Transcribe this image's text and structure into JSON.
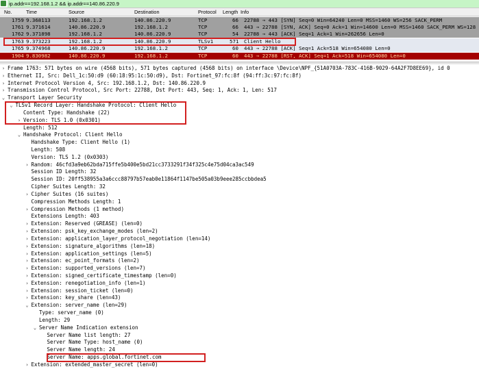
{
  "filter": {
    "value": "ip.addr==192.168.1.2 && ip.addr==140.86.220.9"
  },
  "columns": [
    "No.",
    "Time",
    "Source",
    "Destination",
    "Protocol",
    "Length",
    "Info"
  ],
  "packets": [
    {
      "no": "1759",
      "time": "9.368113",
      "src": "192.168.1.2",
      "dst": "140.86.220.9",
      "proto": "TCP",
      "len": "66",
      "info": "22788 → 443 [SYN] Seq=0 Win=64240 Len=0 MSS=1460 WS=256 SACK_PERM"
    },
    {
      "no": "1761",
      "time": "9.371614",
      "src": "140.86.220.9",
      "dst": "192.168.1.2",
      "proto": "TCP",
      "len": "66",
      "info": "443 → 22788 [SYN, ACK] Seq=0 Ack=1 Win=14600 Len=0 MSS=1460 SACK_PERM WS=128"
    },
    {
      "no": "1762",
      "time": "9.371898",
      "src": "192.168.1.2",
      "dst": "140.86.220.9",
      "proto": "TCP",
      "len": "54",
      "info": "22788 → 443 [ACK] Seq=1 Ack=1 Win=262656 Len=0"
    },
    {
      "no": "1763",
      "time": "9.373223",
      "src": "192.168.1.2",
      "dst": "140.86.220.9",
      "proto": "TLSv1",
      "len": "571",
      "info": "Client Hello"
    },
    {
      "no": "1765",
      "time": "9.374968",
      "src": "140.86.220.9",
      "dst": "192.168.1.2",
      "proto": "TCP",
      "len": "60",
      "info": "443 → 22788 [ACK] Seq=1 Ack=518 Win=654080 Len=0"
    },
    {
      "no": "1904",
      "time": "9.830982",
      "src": "140.86.220.9",
      "dst": "192.168.1.2",
      "proto": "TCP",
      "len": "60",
      "info": "443 → 22788 [RST, ACK] Seq=1 Ack=518 Win=654080 Len=0"
    }
  ],
  "details": [
    {
      "t": ">",
      "text": "Frame 1763: 571 bytes on wire (4568 bits), 571 bytes captured (4568 bits) on interface \\Device\\NPF_{51A0703A-783C-416B-9029-64A2F7D8EE69}, id 0"
    },
    {
      "t": ">",
      "text": "Ethernet II, Src: Dell_1c:50:d9 (60:18:95:1c:50:d9), Dst: Fortinet_97:fc:8f (94:ff:3c:97:fc:8f)"
    },
    {
      "t": ">",
      "text": "Internet Protocol Version 4, Src: 192.168.1.2, Dst: 140.86.220.9"
    },
    {
      "t": ">",
      "text": "Transmission Control Protocol, Src Port: 22788, Dst Port: 443, Seq: 1, Ack: 1, Len: 517"
    },
    {
      "t": "v",
      "text": "Transport Layer Security"
    },
    {
      "t": "v",
      "text": "TLSv1 Record Layer: Handshake Protocol: Client Hello"
    },
    {
      "t": "",
      "text": "Content Type: Handshake (22)"
    },
    {
      "t": ">",
      "text": "Version: TLS 1.0 (0x0301)"
    },
    {
      "t": "",
      "text": "Length: 512"
    },
    {
      "t": "v",
      "text": "Handshake Protocol: Client Hello"
    },
    {
      "t": "",
      "text": "Handshake Type: Client Hello (1)"
    },
    {
      "t": "",
      "text": "Length: 508"
    },
    {
      "t": "",
      "text": "Version: TLS 1.2 (0x0303)"
    },
    {
      "t": ">",
      "text": "Random: 46cfd3a9eb62bda715ffe5b400e5bd21cc3733291f34f325c4e75d04ca3ac549"
    },
    {
      "t": "",
      "text": "Session ID Length: 32"
    },
    {
      "t": "",
      "text": "Session ID: 20ff538955a3a6ccc88797b57eab0e11864f1147be505a03b9eee285ccbbdea5"
    },
    {
      "t": "",
      "text": "Cipher Suites Length: 32"
    },
    {
      "t": ">",
      "text": "Cipher Suites (16 suites)"
    },
    {
      "t": "",
      "text": "Compression Methods Length: 1"
    },
    {
      "t": ">",
      "text": "Compression Methods (1 method)"
    },
    {
      "t": "",
      "text": "Extensions Length: 403"
    },
    {
      "t": ">",
      "text": "Extension: Reserved (GREASE) (len=0)"
    },
    {
      "t": ">",
      "text": "Extension: psk_key_exchange_modes (len=2)"
    },
    {
      "t": ">",
      "text": "Extension: application_layer_protocol_negotiation (len=14)"
    },
    {
      "t": ">",
      "text": "Extension: signature_algorithms (len=18)"
    },
    {
      "t": ">",
      "text": "Extension: application_settings (len=5)"
    },
    {
      "t": ">",
      "text": "Extension: ec_point_formats (len=2)"
    },
    {
      "t": ">",
      "text": "Extension: supported_versions (len=7)"
    },
    {
      "t": ">",
      "text": "Extension: signed_certificate_timestamp (len=0)"
    },
    {
      "t": ">",
      "text": "Extension: renegotiation_info (len=1)"
    },
    {
      "t": ">",
      "text": "Extension: session_ticket (len=0)"
    },
    {
      "t": ">",
      "text": "Extension: key_share (len=43)"
    },
    {
      "t": "v",
      "text": "Extension: server_name (len=29)"
    },
    {
      "t": "",
      "text": "Type: server_name (0)"
    },
    {
      "t": "",
      "text": "Length: 29"
    },
    {
      "t": "v",
      "text": "Server Name Indication extension"
    },
    {
      "t": "",
      "text": "Server Name list length: 27"
    },
    {
      "t": "",
      "text": "Server Name Type: host_name (0)"
    },
    {
      "t": "",
      "text": "Server Name length: 24"
    },
    {
      "t": "",
      "text": "Server Name: apps.global.fortinet.com"
    },
    {
      "t": ">",
      "text": "Extension: extended_master_secret (len=0)"
    }
  ]
}
